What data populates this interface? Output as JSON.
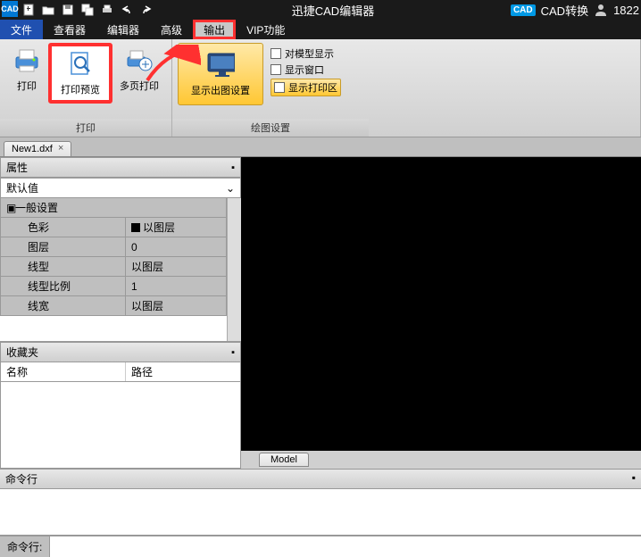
{
  "titlebar": {
    "app_icon_text": "CAD",
    "title": "迅捷CAD编辑器",
    "convert_label": "CAD转换",
    "user_text": "1822"
  },
  "menu": {
    "file": "文件",
    "viewer": "查看器",
    "editor": "编辑器",
    "advanced": "高级",
    "output": "输出",
    "vip": "VIP功能"
  },
  "ribbon": {
    "group_print": "打印",
    "print": "打印",
    "print_preview": "打印预览",
    "multi_print": "多页打印",
    "group_plot_settings": "绘图设置",
    "show_plot_settings": "显示出图设置",
    "model_display": "对模型显示",
    "show_window": "显示窗口",
    "show_print_area": "显示打印区"
  },
  "file_tab": {
    "name": "New1.dxf"
  },
  "panels": {
    "properties": "属性",
    "default_value": "默认值",
    "general_settings": "一般设置",
    "rows": [
      {
        "k": "色彩",
        "v": "以图层",
        "swatch": true
      },
      {
        "k": "图层",
        "v": "0"
      },
      {
        "k": "线型",
        "v": "以图层"
      },
      {
        "k": "线型比例",
        "v": "1"
      },
      {
        "k": "线宽",
        "v": "以图层"
      }
    ],
    "favorites": "收藏夹",
    "col_name": "名称",
    "col_path": "路径"
  },
  "canvas": {
    "model_tab": "Model"
  },
  "cmd": {
    "header": "命令行",
    "prompt": "命令行:"
  }
}
